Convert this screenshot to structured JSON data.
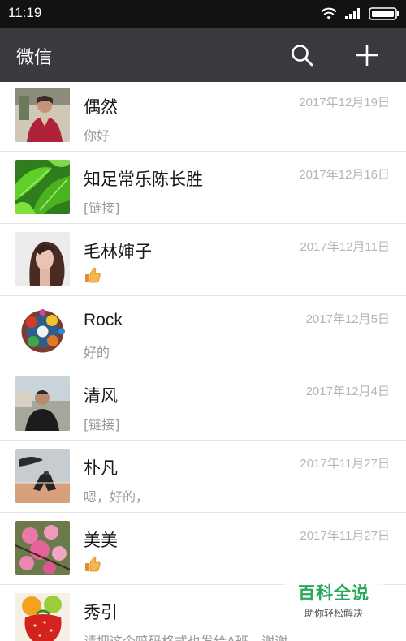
{
  "status_bar": {
    "time": "11:19"
  },
  "app_bar": {
    "title": "微信",
    "search_icon": "search-icon",
    "add_icon": "plus-icon"
  },
  "chats": [
    {
      "name": "偶然",
      "preview": "你好",
      "date": "2017年12月19日"
    },
    {
      "name": "知足常乐陈长胜",
      "preview": "[链接]",
      "date": "2017年12月16日"
    },
    {
      "name": "毛林婶子",
      "preview": "",
      "preview_icon": "thumbs-up-emoji",
      "date": "2017年12月11日"
    },
    {
      "name": "Rock",
      "preview": "好的",
      "date": "2017年12月5日"
    },
    {
      "name": "清风",
      "preview": "[链接]",
      "date": "2017年12月4日"
    },
    {
      "name": "朴凡",
      "preview": "嗯，好的，",
      "date": "2017年11月27日"
    },
    {
      "name": "美美",
      "preview": "",
      "preview_icon": "thumbs-up-emoji",
      "date": "2017年11月27日"
    },
    {
      "name": "秀引",
      "preview": "请把这个喷码格式也发给A班，谢谢",
      "date": ""
    }
  ],
  "watermark": {
    "title": "百科全说",
    "subtitle": "助你轻松解决"
  },
  "colors": {
    "status_bar": "#121212",
    "app_bar": "#393a3f",
    "date": "#b5b5b5",
    "preview": "#9a9a9a"
  }
}
